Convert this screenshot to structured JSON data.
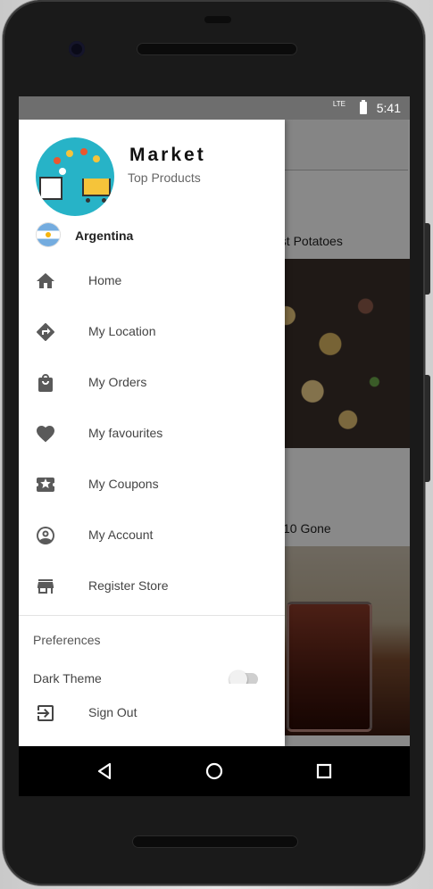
{
  "status_bar": {
    "network": "LTE",
    "time": "5:41"
  },
  "background_app": {
    "card_titles": [
      "ast Potatoes",
      "10 Gone"
    ]
  },
  "drawer": {
    "app_name": "Market",
    "subtitle": "Top Products",
    "country": "Argentina",
    "menu": [
      {
        "label": "Home",
        "icon": "home-icon"
      },
      {
        "label": "My Location",
        "icon": "directions-icon"
      },
      {
        "label": "My Orders",
        "icon": "shopping-bag-icon"
      },
      {
        "label": "My favourites",
        "icon": "heart-icon"
      },
      {
        "label": "My Coupons",
        "icon": "coupon-icon"
      },
      {
        "label": "My Account",
        "icon": "account-circle-icon"
      },
      {
        "label": "Register Store",
        "icon": "store-icon"
      }
    ],
    "preferences_title": "Preferences",
    "dark_theme_label": "Dark Theme",
    "sign_out_label": "Sign Out"
  },
  "nav": {
    "buttons": [
      "back-icon",
      "home-circle-icon",
      "recents-icon"
    ]
  },
  "colors": {
    "logo_bg": "#27b3c7",
    "icon_gray": "#5a5a5a",
    "scrim": "rgba(0,0,0,0.45)"
  }
}
